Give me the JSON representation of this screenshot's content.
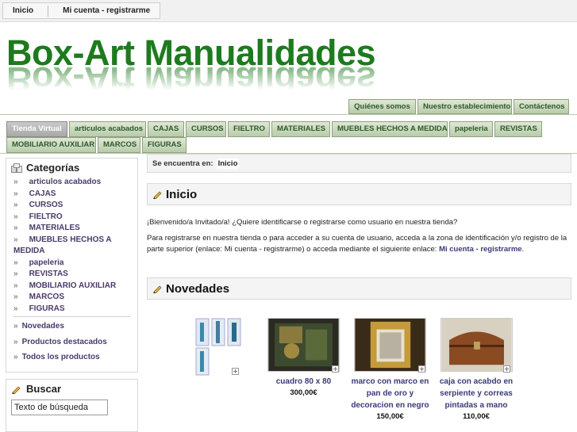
{
  "topbar": {
    "home": "Inicio",
    "account": "Mi cuenta - registrarme"
  },
  "site": {
    "title": "Box-Art Manualidades"
  },
  "top_tabs": [
    "Quiénes somos",
    "Nuestro establecimiento",
    "Contáctenos"
  ],
  "nav_tabs_row1": [
    "Tienda Virtual",
    "articulos acabados",
    "CAJAS",
    "CURSOS",
    "FIELTRO",
    "MATERIALES",
    "MUEBLES HECHOS A MEDIDA",
    "papeleria",
    "REVISTAS"
  ],
  "nav_tabs_row2": [
    "MOBILIARIO AUXILIAR",
    "MARCOS",
    "FIGURAS"
  ],
  "sidebar": {
    "categories_title": "Categorías",
    "categories": [
      "articulos acabados",
      "CAJAS",
      "CURSOS",
      "FIELTRO",
      "MATERIALES",
      "MUEBLES HECHOS A MEDIDA",
      "papeleria",
      "REVISTAS",
      "MOBILIARIO AUXILIAR",
      "MARCOS",
      "FIGURAS"
    ],
    "links": [
      "Novedades",
      "Productos destacados",
      "Todos los productos"
    ],
    "search_title": "Buscar",
    "search_value": "Texto de búsqueda"
  },
  "breadcrumb": {
    "label": "Se encuentra en:",
    "current": "Inicio"
  },
  "main": {
    "inicio_title": "Inicio",
    "welcome": "¡Bienvenido/a Invitado/a! ¿Quiere identificarse o registrarse como usuario en nuestra tienda?",
    "register_text": "Para registrarse en nuestra tienda o para acceder a su cuenta de usuario, acceda a la zona de identificación y/o registro de la parte superior (enlace: Mi cuenta - registrarme) o acceda mediante el siguiente enlace:",
    "register_link": "Mi cuenta - registrarme",
    "register_end": ".",
    "novedades_title": "Novedades"
  },
  "products": [
    {
      "name": "",
      "price": ""
    },
    {
      "name": "cuadro 80 x 80",
      "price": "300,00€"
    },
    {
      "name": "marco con marco en pan de oro y decoracion en negro",
      "price": "150,00€"
    },
    {
      "name": "caja con acabdo en serpiente y correas pintadas a mano",
      "price": "110,00€"
    }
  ],
  "colors": {
    "brand_green": "#1e7a1e",
    "tab_green": "#b9cbaa",
    "link_purple": "#3a3a7a"
  }
}
